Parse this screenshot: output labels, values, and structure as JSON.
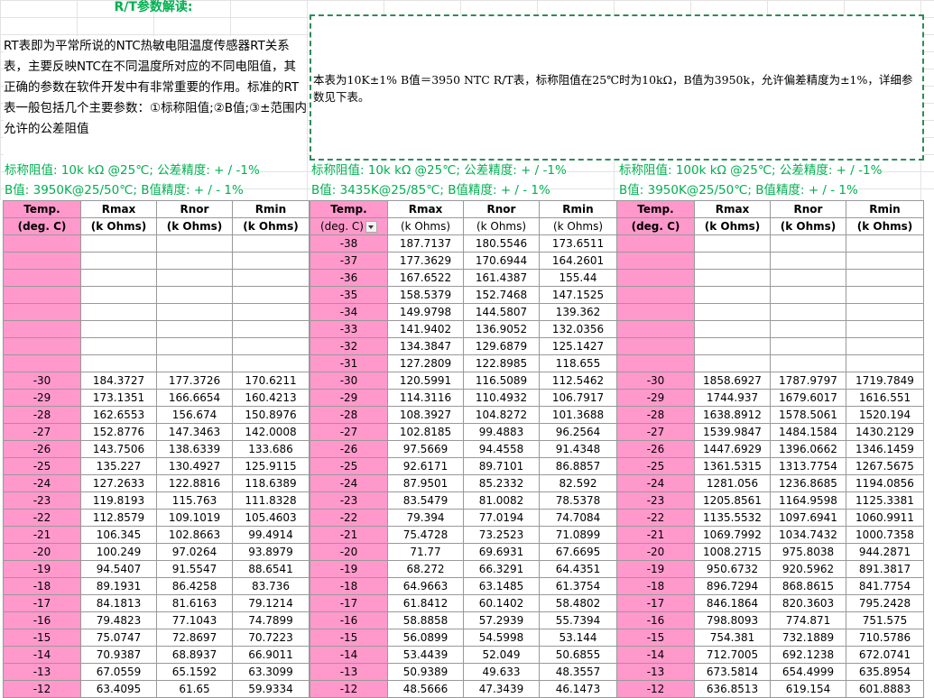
{
  "title": "R/T参数解读:",
  "description_left": "RT表即为平常所说的NTC热敏电阻温度传感器RT关系表，主要反映NTC在不同温度所对应的不同电阻值，其正确的参数在软件开发中有非常重要的作用。标准的RT表一般包括几个主要参数：①标称阻值;②B值;③±范围内允许的公差阻值",
  "description_right": "本表为10K±1% B值＝3950 NTC R/T表，标称阻值在25℃时为10kΩ，B值为3950k，允许偏差精度为±1%，详细参数见下表。",
  "columns": {
    "header1": [
      "Temp.",
      "Rmax",
      "Rnor",
      "Rmin"
    ],
    "header2": [
      "(deg. C)",
      "(k Ohms)",
      "(k Ohms)",
      "(k Ohms)"
    ]
  },
  "tables": [
    {
      "param1": "标称阻值:  10k kΩ @25℃;  公差精度:   + / -1%",
      "param2": "B值:  3950K@25/50℃;  B值精度:  + / - 1%",
      "pre_rows": [],
      "rows": [
        [
          "-30",
          "184.3727",
          "177.3726",
          "170.6211"
        ],
        [
          "-29",
          "173.1351",
          "166.6654",
          "160.4213"
        ],
        [
          "-28",
          "162.6553",
          "156.674",
          "150.8976"
        ],
        [
          "-27",
          "152.8776",
          "147.3463",
          "142.0008"
        ],
        [
          "-26",
          "143.7506",
          "138.6339",
          "133.686"
        ],
        [
          "-25",
          "135.227",
          "130.4927",
          "125.9115"
        ],
        [
          "-24",
          "127.2633",
          "122.8816",
          "118.6389"
        ],
        [
          "-23",
          "119.8193",
          "115.763",
          "111.8328"
        ],
        [
          "-22",
          "112.8579",
          "109.1019",
          "105.4603"
        ],
        [
          "-21",
          "106.345",
          "102.8663",
          "99.4914"
        ],
        [
          "-20",
          "100.249",
          "97.0264",
          "93.8979"
        ],
        [
          "-19",
          "94.5407",
          "91.5547",
          "88.6541"
        ],
        [
          "-18",
          "89.1931",
          "86.4258",
          "83.736"
        ],
        [
          "-17",
          "84.1813",
          "81.6163",
          "79.1214"
        ],
        [
          "-16",
          "79.4823",
          "77.1043",
          "74.7899"
        ],
        [
          "-15",
          "75.0747",
          "72.8697",
          "70.7223"
        ],
        [
          "-14",
          "70.9387",
          "68.8937",
          "66.9011"
        ],
        [
          "-13",
          "67.0559",
          "65.1592",
          "63.3099"
        ],
        [
          "-12",
          "63.4095",
          "61.65",
          "59.9334"
        ]
      ]
    },
    {
      "param1": "标称阻值:  10k kΩ @25℃;  公差精度:   + / -1%",
      "param2": "B值:  3435K@25/85℃;  B值精度:  + / - 1%",
      "pre_rows": [
        [
          "-38",
          "187.7137",
          "180.5546",
          "173.6511"
        ],
        [
          "-37",
          "177.3629",
          "170.6944",
          "164.2601"
        ],
        [
          "-36",
          "167.6522",
          "161.4387",
          "155.44"
        ],
        [
          "-35",
          "158.5379",
          "152.7468",
          "147.1525"
        ],
        [
          "-34",
          "149.9798",
          "144.5807",
          "139.362"
        ],
        [
          "-33",
          "141.9402",
          "136.9052",
          "132.0356"
        ],
        [
          "-32",
          "134.3847",
          "129.6879",
          "125.1427"
        ],
        [
          "-31",
          "127.2809",
          "122.8985",
          "118.655"
        ]
      ],
      "rows": [
        [
          "-30",
          "120.5991",
          "116.5089",
          "112.5462"
        ],
        [
          "-29",
          "114.3116",
          "110.4932",
          "106.7917"
        ],
        [
          "-28",
          "108.3927",
          "104.8272",
          "101.3688"
        ],
        [
          "-27",
          "102.8185",
          "99.4883",
          "96.2564"
        ],
        [
          "-26",
          "97.5669",
          "94.4558",
          "91.4348"
        ],
        [
          "-25",
          "92.6171",
          "89.7101",
          "86.8857"
        ],
        [
          "-24",
          "87.9501",
          "85.2332",
          "82.592"
        ],
        [
          "-23",
          "83.5479",
          "81.0082",
          "78.5378"
        ],
        [
          "-22",
          "79.394",
          "77.0194",
          "74.7084"
        ],
        [
          "-21",
          "75.4728",
          "73.2523",
          "71.0899"
        ],
        [
          "-20",
          "71.77",
          "69.6931",
          "67.6695"
        ],
        [
          "-19",
          "68.272",
          "66.3291",
          "64.4351"
        ],
        [
          "-18",
          "64.9663",
          "63.1485",
          "61.3754"
        ],
        [
          "-17",
          "61.8412",
          "60.1402",
          "58.4802"
        ],
        [
          "-16",
          "58.8858",
          "57.2939",
          "55.7394"
        ],
        [
          "-15",
          "56.0899",
          "54.5998",
          "53.144"
        ],
        [
          "-14",
          "53.4439",
          "52.049",
          "50.6855"
        ],
        [
          "-13",
          "50.9389",
          "49.633",
          "48.3557"
        ],
        [
          "-12",
          "48.5666",
          "47.3439",
          "46.1473"
        ]
      ]
    },
    {
      "param1": "标称阻值:  100k kΩ @25℃;  公差精度:   + / -1%",
      "param2": "B值:  3950K@25/50℃;  B值精度:  + / - 1%",
      "pre_rows": [],
      "rows": [
        [
          "-30",
          "1858.6927",
          "1787.9797",
          "1719.7849"
        ],
        [
          "-29",
          "1744.937",
          "1679.6017",
          "1616.551"
        ],
        [
          "-28",
          "1638.8912",
          "1578.5061",
          "1520.194"
        ],
        [
          "-27",
          "1539.9847",
          "1484.1584",
          "1430.2129"
        ],
        [
          "-26",
          "1447.6929",
          "1396.0662",
          "1346.1459"
        ],
        [
          "-25",
          "1361.5315",
          "1313.7754",
          "1267.5675"
        ],
        [
          "-24",
          "1281.056",
          "1236.8685",
          "1194.0856"
        ],
        [
          "-23",
          "1205.8561",
          "1164.9598",
          "1125.3381"
        ],
        [
          "-22",
          "1135.5532",
          "1097.6941",
          "1060.9911"
        ],
        [
          "-21",
          "1069.7992",
          "1034.7432",
          "1000.7358"
        ],
        [
          "-20",
          "1008.2715",
          "975.8038",
          "944.2871"
        ],
        [
          "-19",
          "950.6732",
          "920.5962",
          "891.3817"
        ],
        [
          "-18",
          "896.7294",
          "868.8615",
          "841.7754"
        ],
        [
          "-17",
          "846.1864",
          "820.3603",
          "795.2428"
        ],
        [
          "-16",
          "798.8093",
          "774.871",
          "751.575"
        ],
        [
          "-15",
          "754.381",
          "732.1889",
          "710.5786"
        ],
        [
          "-14",
          "712.7005",
          "692.1238",
          "672.0741"
        ],
        [
          "-13",
          "673.5814",
          "654.4999",
          "635.8954"
        ],
        [
          "-12",
          "636.8513",
          "619.154",
          "601.8883"
        ]
      ]
    }
  ]
}
